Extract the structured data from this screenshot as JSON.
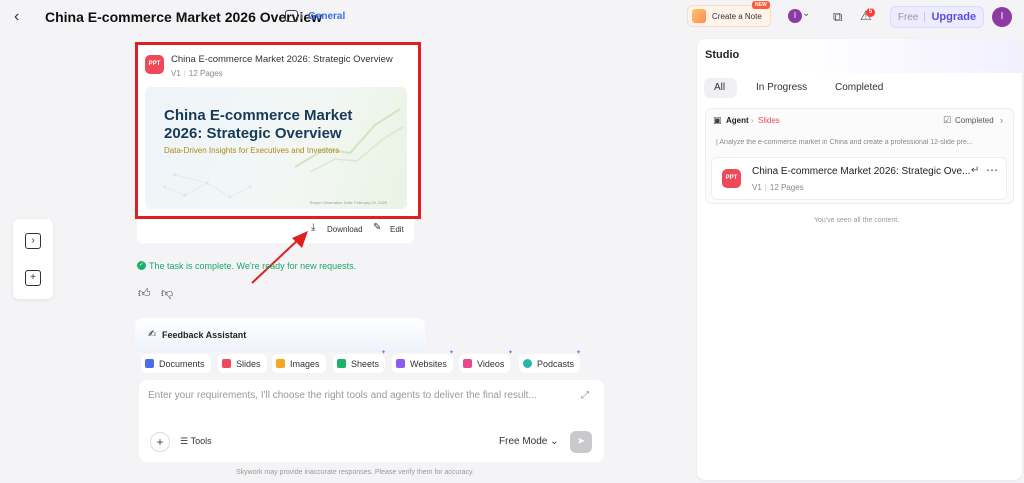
{
  "header": {
    "back_icon": "arrow-left-icon",
    "title": "China E-commerce Market 2026 Overview",
    "project_sep": "I",
    "project_name": "General",
    "create_note_label": "Create a Note",
    "new_badge": "NEW",
    "avatar_initial": "I",
    "notifications_count": "5",
    "free_label": "Free",
    "upgrade_label": "Upgrade"
  },
  "artifact": {
    "badge": "PPT",
    "title": "China E-commerce Market 2026: Strategic Overview",
    "version": "V1",
    "pages": "12 Pages",
    "thumb_title": "China E-commerce Market 2026: Strategic Overview",
    "thumb_subtitle": "Data-Driven Insights for Executives and Investors",
    "thumb_date": "Report Generation Date: February 24, 2026",
    "download_label": "Download",
    "edit_label": "Edit"
  },
  "status": {
    "complete_message": "The task is complete. We're ready for new requests."
  },
  "feedback": {
    "title": "Feedback Assistant"
  },
  "tools": [
    {
      "label": "Documents",
      "color": "#4a6cf0"
    },
    {
      "label": "Slides",
      "color": "#f0495a"
    },
    {
      "label": "Images",
      "color": "#f5a623"
    },
    {
      "label": "Sheets",
      "color": "#19b36b"
    },
    {
      "label": "Websites",
      "color": "#8a5cf0"
    },
    {
      "label": "Videos",
      "color": "#e8488c"
    },
    {
      "label": "Podcasts",
      "color": "#2bb5a8"
    }
  ],
  "composer": {
    "placeholder": "Enter your requirements, I'll choose the right tools and agents to deliver the final result...",
    "tools_label": "Tools",
    "mode_label": "Free Mode",
    "disclaimer": "Skywork may provide inaccurate responses. Please verify them for accuracy."
  },
  "studio": {
    "title": "Studio",
    "tabs": [
      "All",
      "In Progress",
      "Completed"
    ],
    "active_tab": "All",
    "task": {
      "agent_label": "Agent",
      "agent_type": "Slides",
      "status": "Completed",
      "prompt": "Analyze the e-commerce market in China and create a professional 12-slide pre...",
      "item_badge": "PPT",
      "item_title": "China E-commerce Market 2026: Strategic Ove...",
      "item_version": "V1",
      "item_pages": "12 Pages"
    },
    "end_message": "You've seen all the content."
  }
}
